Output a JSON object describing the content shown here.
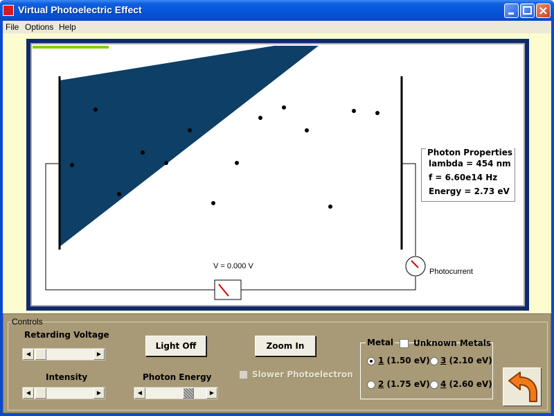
{
  "window": {
    "title": "Virtual Photoelectric Effect"
  },
  "menu": [
    {
      "label": "File"
    },
    {
      "label": "Options"
    },
    {
      "label": "Help"
    }
  ],
  "simulation": {
    "voltage_readout": "V = 0.000 V",
    "photocurrent_label": "Photocurrent",
    "photon_properties": {
      "title": "Photon Properties",
      "lambda": "lambda = 454 nm",
      "frequency": "f = 6.60e14 Hz",
      "energy": "Energy =  2.73 eV"
    },
    "colors": {
      "beam": "#0e3f66",
      "frame": "#0e2a6e",
      "indicator": "#80d000",
      "meter_needle": "#d00000"
    }
  },
  "controls": {
    "title": "Controls",
    "retarding_voltage": {
      "label": "Retarding Voltage"
    },
    "intensity": {
      "label": "Intensity"
    },
    "photon_energy": {
      "label": "Photon Energy"
    },
    "light_button": "Light Off",
    "zoom_button": "Zoom In",
    "slower_checkbox": {
      "label": "Slower Photoelectron",
      "checked": false,
      "enabled": false
    },
    "metal": {
      "legend": "Metal",
      "unknown_label": "Unknown Metals",
      "unknown_checked": false,
      "options": [
        {
          "num": "1",
          "label": "(1.50 eV)",
          "selected": true
        },
        {
          "num": "3",
          "label": "(2.10 eV)",
          "selected": false
        },
        {
          "num": "2",
          "label": "(1.75 eV)",
          "selected": false
        },
        {
          "num": "4",
          "label": "(2.60 eV)",
          "selected": false
        }
      ]
    },
    "back_icon": "back-arrow-icon"
  }
}
